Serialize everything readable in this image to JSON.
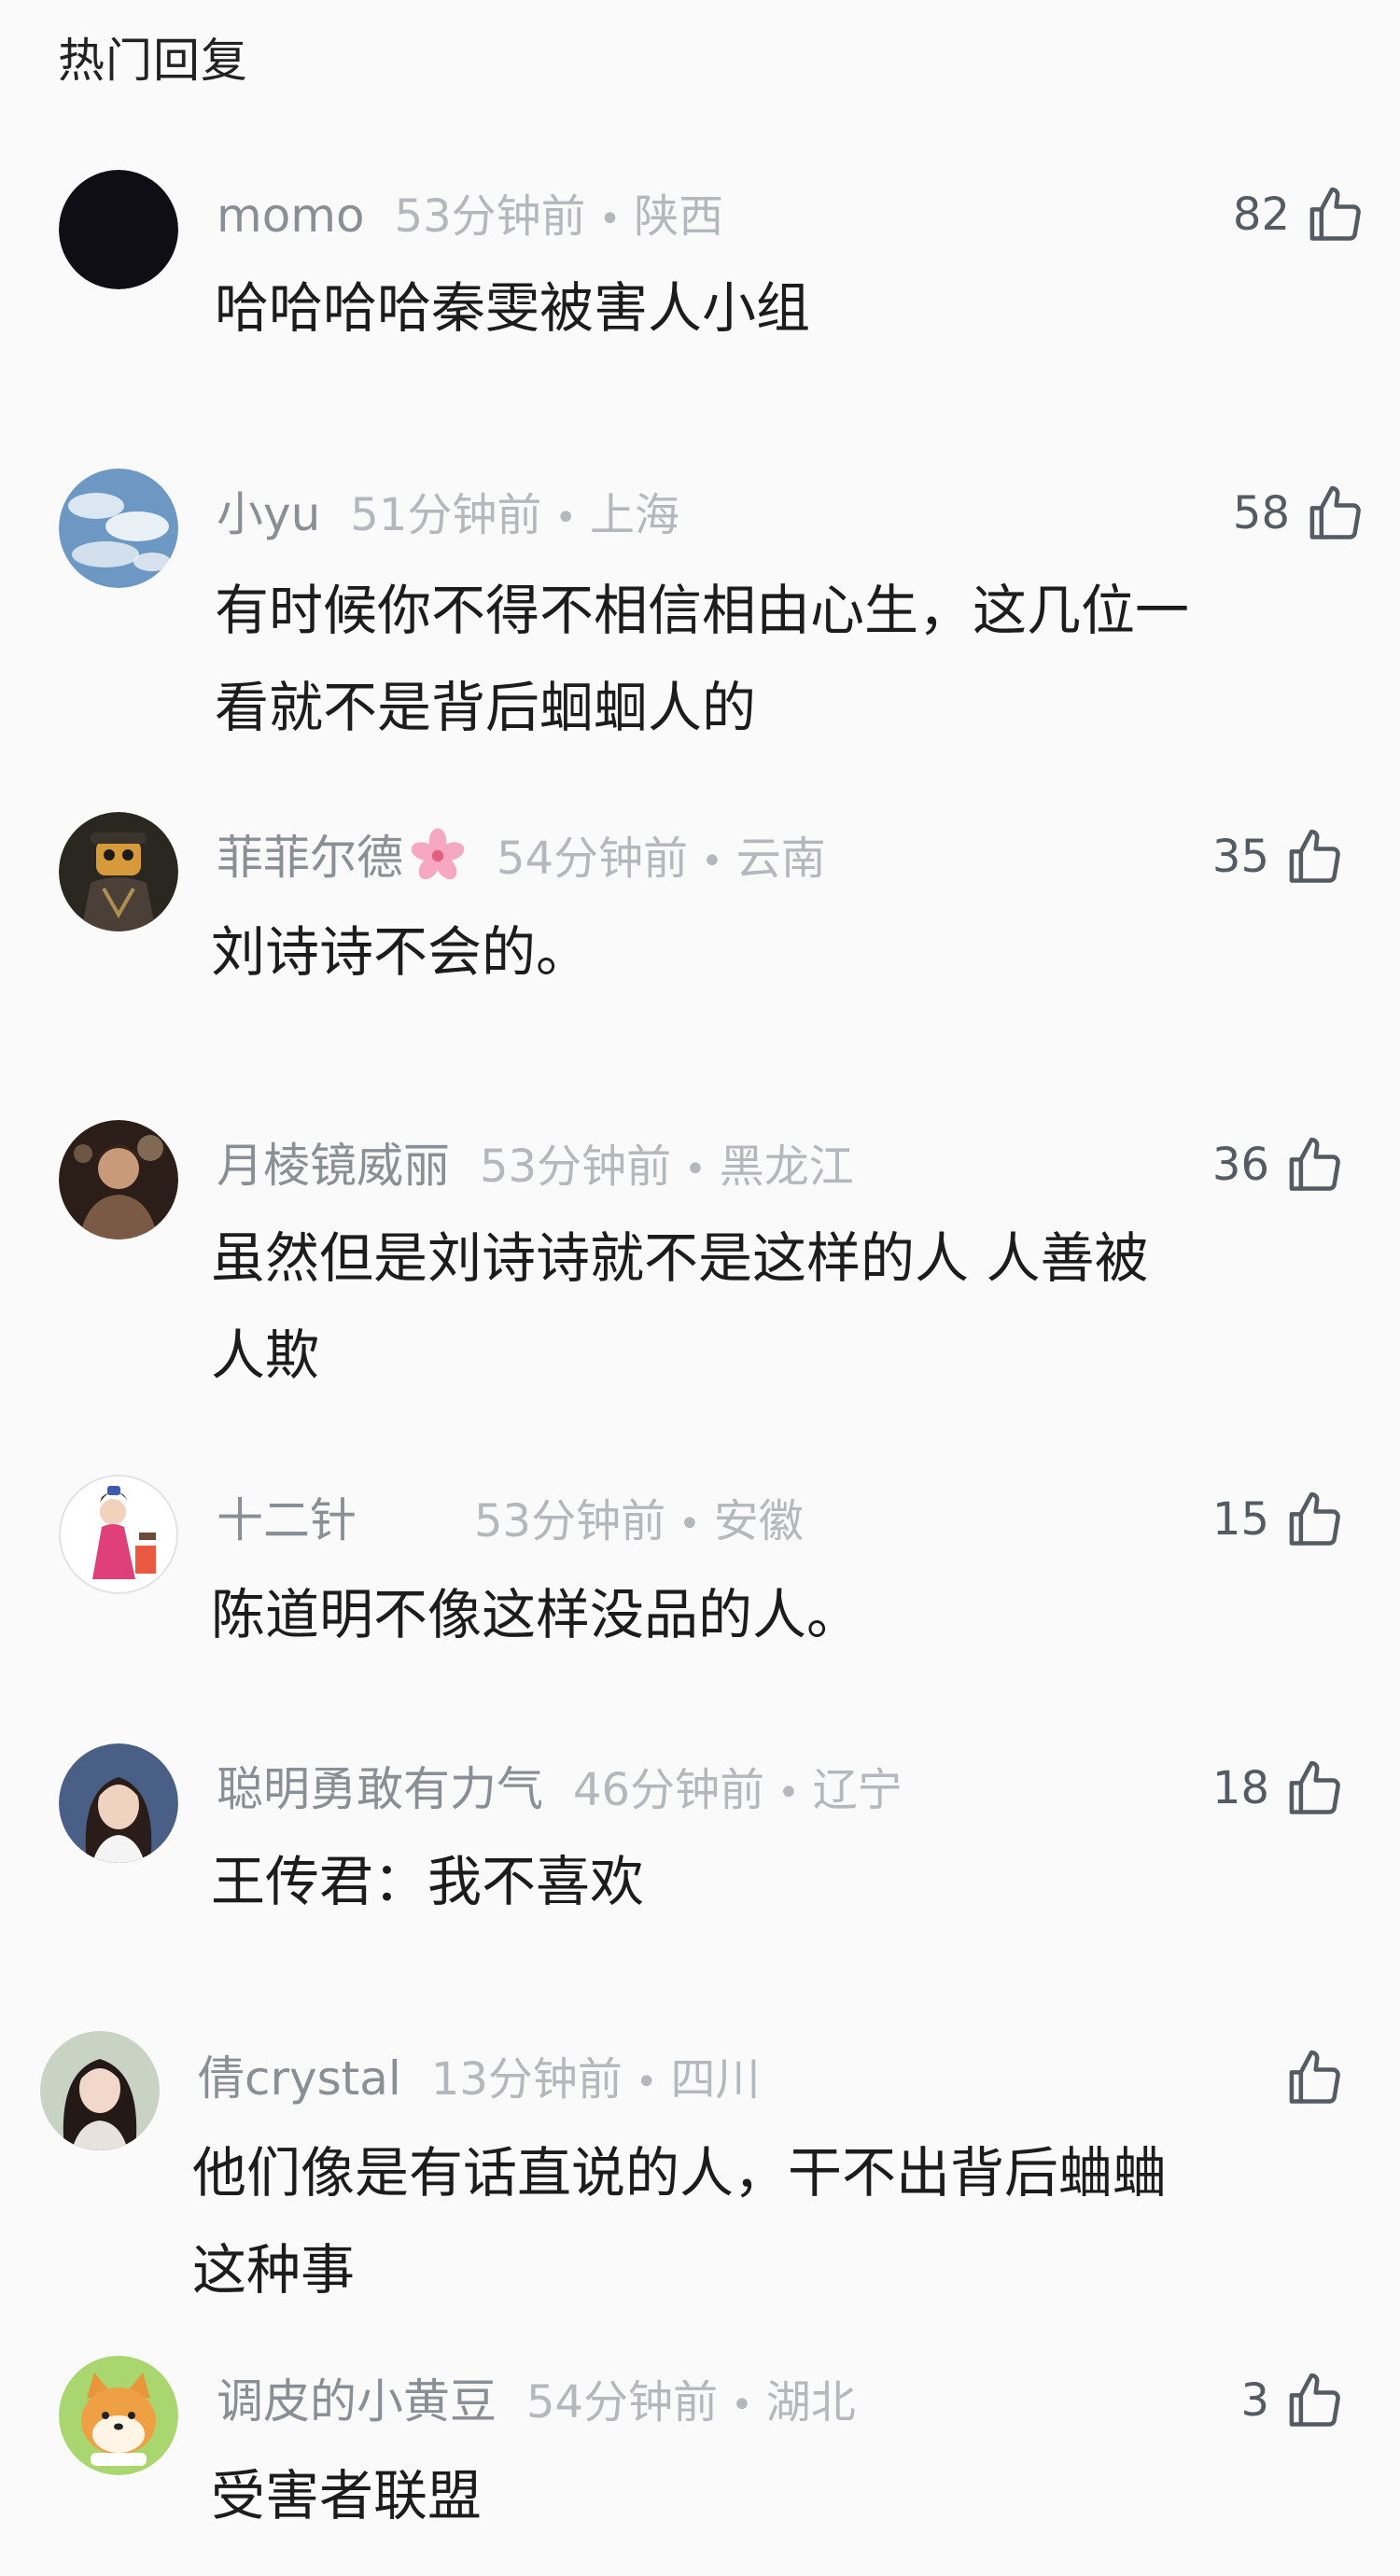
{
  "header": {
    "title": "热门回复"
  },
  "comments": [
    {
      "username": "momo",
      "time": "53分钟前",
      "location": "陕西",
      "likes": "82",
      "lines": [
        "哈哈哈哈秦雯被害人小组"
      ],
      "avatar": "dark-circle-avatar"
    },
    {
      "username": "小yu",
      "time": "51分钟前",
      "location": "上海",
      "likes": "58",
      "lines": [
        "有时候你不得不相信相由心生，这几位一",
        "看就不是背后蛔蛔人的"
      ],
      "avatar": "sky-clouds-avatar"
    },
    {
      "username": "菲菲尔德",
      "time": "54分钟前",
      "location": "云南",
      "likes": "35",
      "lines": [
        "刘诗诗不会的。"
      ],
      "avatar": "cartoon-character-avatar",
      "name_emoji": "cherry-blossom-icon"
    },
    {
      "username": "月棱镜威丽",
      "time": "53分钟前",
      "location": "黑龙江",
      "likes": "36",
      "lines": [
        "虽然但是刘诗诗就不是这样的人 人善被",
        "人欺"
      ],
      "avatar": "photo-person-avatar"
    },
    {
      "username": "十二针",
      "time": "53分钟前",
      "location": "安徽",
      "likes": "15",
      "lines": [
        "陈道明不像这样没品的人。"
      ],
      "avatar": "costume-illustration-avatar"
    },
    {
      "username": "聪明勇敢有力气",
      "time": "46分钟前",
      "location": "辽宁",
      "likes": "18",
      "lines": [
        "王传君：我不喜欢"
      ],
      "avatar": "portrait-woman-avatar"
    },
    {
      "username": "倩crystal",
      "time": "13分钟前",
      "location": "四川",
      "likes": "",
      "lines": [
        "他们像是有话直说的人，干不出背后蛐蛐",
        "这种事"
      ],
      "avatar": "portrait-girl-avatar"
    },
    {
      "username": "调皮的小黄豆",
      "time": "54分钟前",
      "location": "湖北",
      "likes": "3",
      "lines": [
        "受害者联盟"
      ],
      "avatar": "shiba-dog-avatar"
    }
  ],
  "colors": {
    "background": "#fafafa",
    "username": "#8a8f96",
    "meta": "#b4b8bd",
    "content": "#1c1c1c"
  },
  "icons": {
    "like": "thumbs-up-icon",
    "separator": "dot"
  }
}
